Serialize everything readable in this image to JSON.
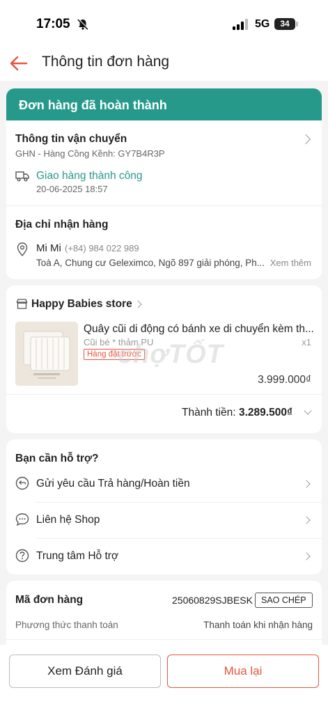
{
  "status_bar": {
    "time": "17:05",
    "network": "5G",
    "battery": "34"
  },
  "header": {
    "title": "Thông tin đơn hàng"
  },
  "order_status": {
    "banner": "Đơn hàng đã hoàn thành"
  },
  "shipping": {
    "title": "Thông tin vận chuyển",
    "carrier": "GHN - Hàng Cồng Kềnh: GY7B4R3P",
    "status": "Giao hàng thành công",
    "date": "20-06-2025 18:57"
  },
  "address": {
    "title": "Địa chỉ nhận hàng",
    "name": "Mi Mi",
    "phone": "(+84) 984 022 989",
    "detail": "Toà A, Chung cư Geleximco, Ngõ 897 giải phóng, Ph...",
    "more": "Xem thêm"
  },
  "store": {
    "name": "Happy Babies store",
    "product": {
      "title": "Quây cũi di động có bánh xe di chuyển kèm th...",
      "variant": "Cũi bé * thảm PU",
      "qty": "x1",
      "tag": "Hàng đặt trước",
      "price": "3.999.000₫"
    },
    "total_label": "Thành tiền:",
    "total_value": "3.289.500₫"
  },
  "watermark": "chợTỐT",
  "support": {
    "title": "Bạn cần hỗ trợ?",
    "items": [
      {
        "label": "Gửi yêu cầu Trả hàng/Hoàn tiền",
        "icon": "return-icon"
      },
      {
        "label": "Liên hệ Shop",
        "icon": "chat-icon"
      },
      {
        "label": "Trung tâm Hỗ trợ",
        "icon": "help-icon"
      }
    ]
  },
  "order_info": {
    "code_label": "Mã đơn hàng",
    "code_value": "25060829SJBESK",
    "copy_label": "SAO CHÉP",
    "payment_label": "Phương thức thanh toán",
    "payment_value": "Thanh toán khi nhận hàng"
  },
  "actions": {
    "review": "Xem Đánh giá",
    "rebuy": "Mua lại"
  },
  "colors": {
    "accent": "#e8543c",
    "teal": "#26998b",
    "success_text": "#26998b"
  }
}
